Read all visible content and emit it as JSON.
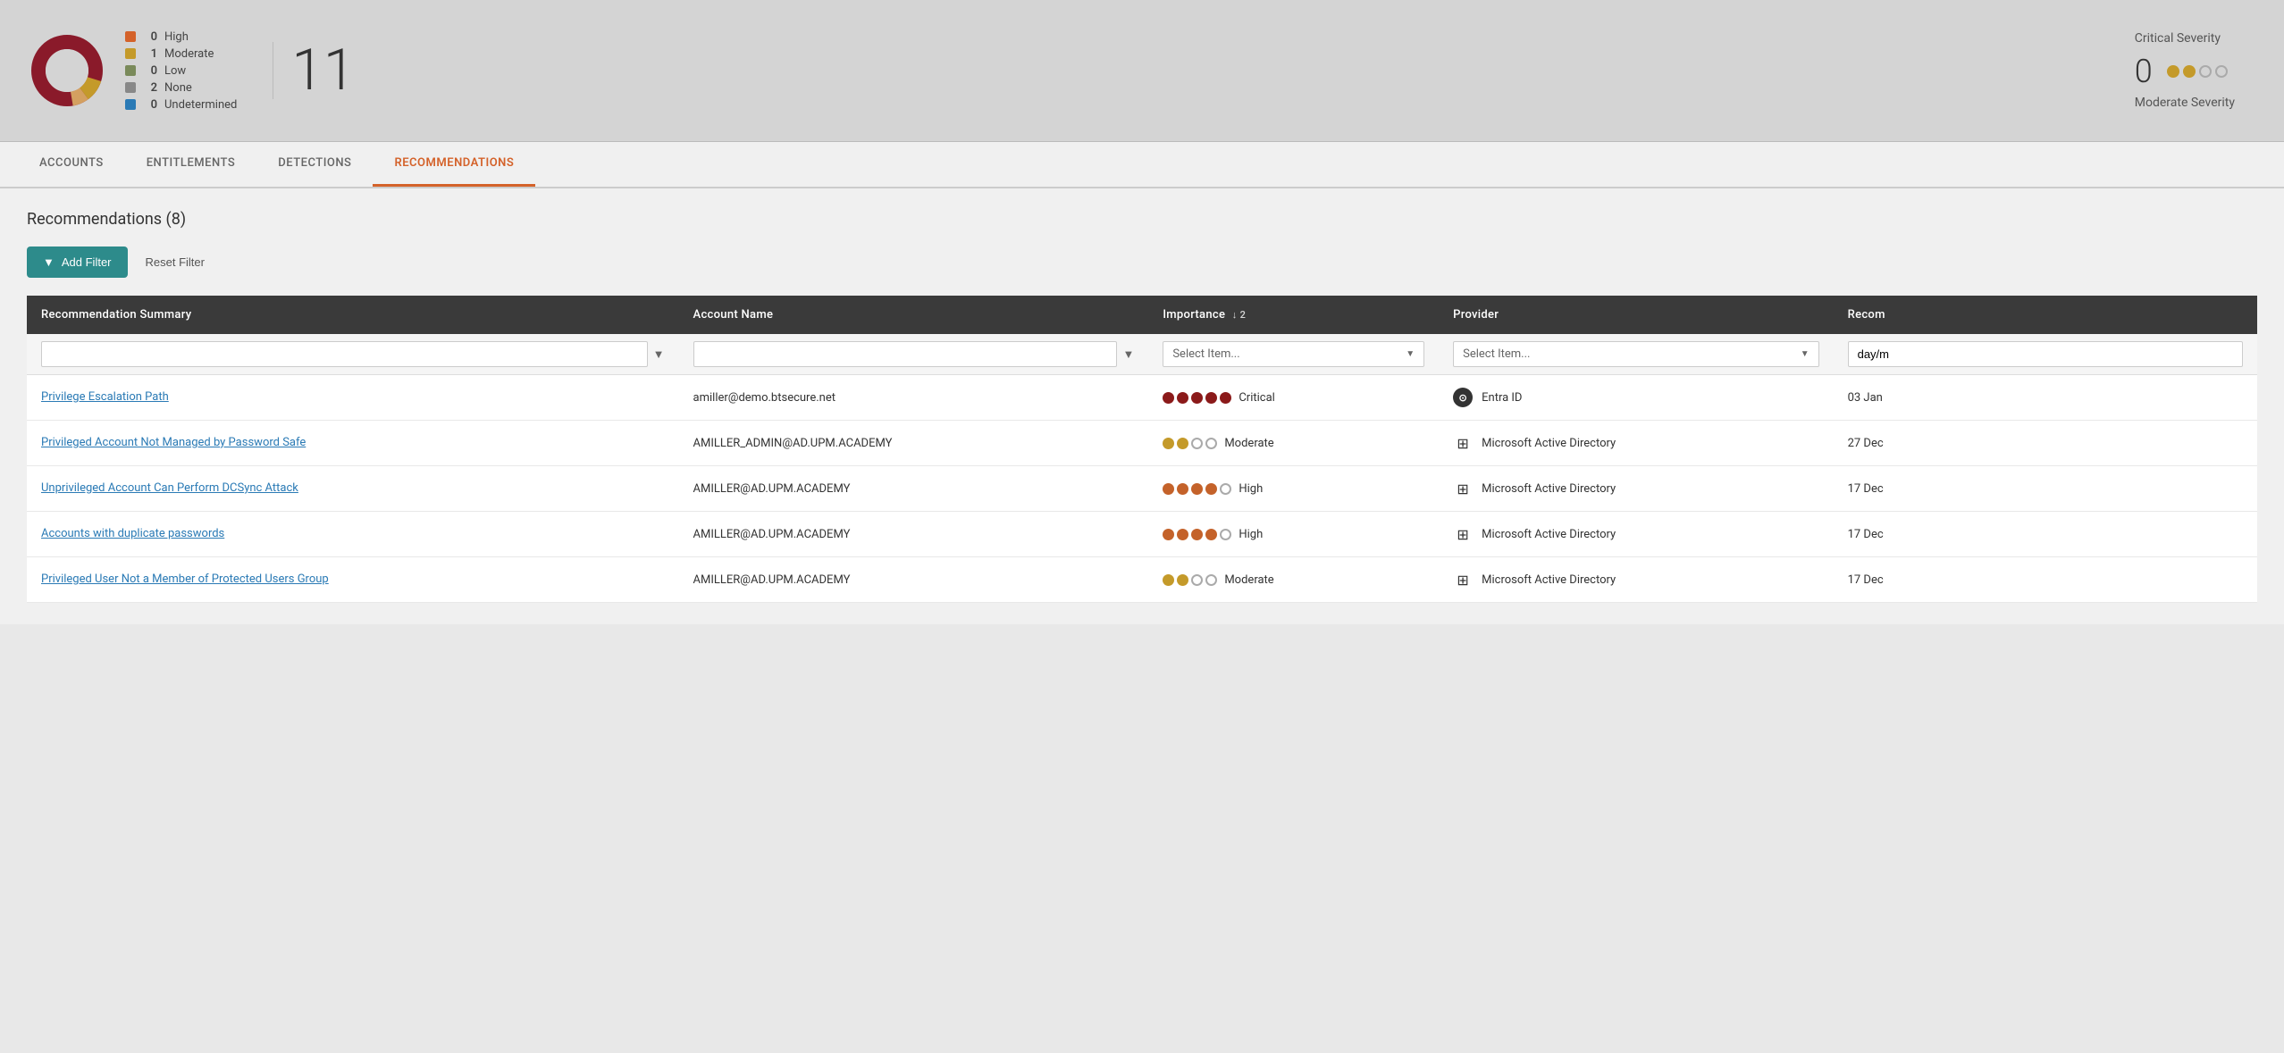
{
  "stats": {
    "legend": [
      {
        "color": "#d4622a",
        "count": "0",
        "label": "High"
      },
      {
        "color": "#c49a2a",
        "count": "1",
        "label": "Moderate"
      },
      {
        "color": "#7a8a5a",
        "count": "0",
        "label": "Low"
      },
      {
        "color": "#888",
        "count": "2",
        "label": "None"
      },
      {
        "color": "#2a7ab5",
        "count": "0",
        "label": "Undetermined"
      }
    ],
    "big_number": "11",
    "critical_severity_title": "Critical Severity",
    "critical_severity_count": "0",
    "moderate_severity_title": "Moderate Severity"
  },
  "tabs": [
    {
      "label": "ACCOUNTS",
      "active": false
    },
    {
      "label": "ENTITLEMENTS",
      "active": false
    },
    {
      "label": "DETECTIONS",
      "active": false
    },
    {
      "label": "RECOMMENDATIONS",
      "active": true
    }
  ],
  "section_title": "Recommendations (8)",
  "filter": {
    "add_label": "Add Filter",
    "reset_label": "Reset Filter"
  },
  "table": {
    "columns": [
      {
        "label": "Recommendation Summary",
        "sort": null
      },
      {
        "label": "Account Name",
        "sort": null
      },
      {
        "label": "Importance",
        "sort": "↓ 2"
      },
      {
        "label": "Provider",
        "sort": null
      },
      {
        "label": "Recom",
        "sort": null
      }
    ],
    "filter_placeholders": {
      "summary": "",
      "account": "",
      "importance": "Select Item...",
      "provider": "Select Item...",
      "recom": "day/m"
    },
    "rows": [
      {
        "summary": "Privilege Escalation Path",
        "account": "amiller@demo.btsecure.net",
        "importance_level": "critical",
        "importance_label": "Critical",
        "provider_type": "entra",
        "provider_label": "Entra ID",
        "date": "03 Jan"
      },
      {
        "summary": "Privileged Account Not Managed by Password Safe",
        "account": "AMILLER_ADMIN@AD.UPM.ACADEMY",
        "importance_level": "moderate",
        "importance_label": "Moderate",
        "provider_type": "ms",
        "provider_label": "Microsoft Active Directory",
        "date": "27 Dec"
      },
      {
        "summary": "Unprivileged Account Can Perform DCSync Attack",
        "account": "AMILLER@AD.UPM.ACADEMY",
        "importance_level": "high",
        "importance_label": "High",
        "provider_type": "ms",
        "provider_label": "Microsoft Active Directory",
        "date": "17 Dec"
      },
      {
        "summary": "Accounts with duplicate passwords",
        "account": "AMILLER@AD.UPM.ACADEMY",
        "importance_level": "high",
        "importance_label": "High",
        "provider_type": "ms",
        "provider_label": "Microsoft Active Directory",
        "date": "17 Dec"
      },
      {
        "summary": "Privileged User Not a Member of Protected Users Group",
        "account": "AMILLER@AD.UPM.ACADEMY",
        "importance_level": "moderate",
        "importance_label": "Moderate",
        "provider_type": "ms",
        "provider_label": "Microsoft Active Directory",
        "date": "17 Dec"
      }
    ]
  }
}
